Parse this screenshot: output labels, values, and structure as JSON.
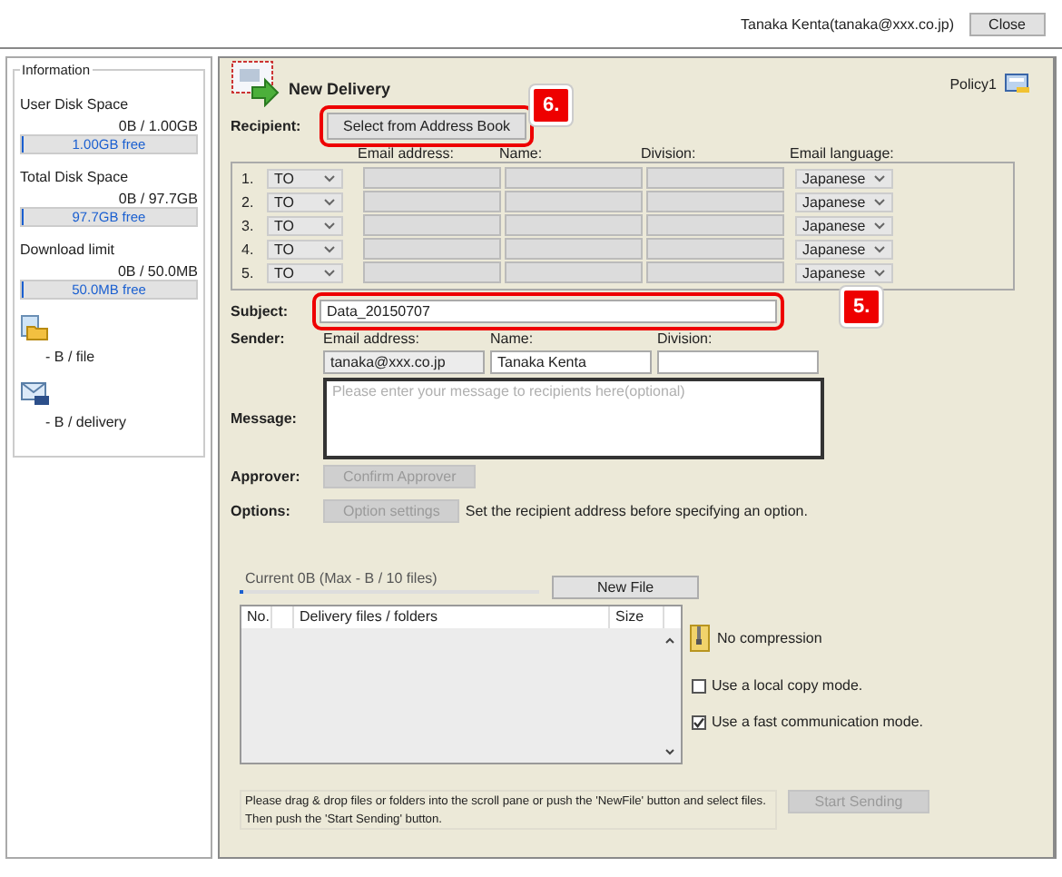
{
  "top_bar": {
    "user": "Tanaka Kenta(tanaka@xxx.co.jp)",
    "close_button": "Close"
  },
  "info_panel": {
    "title": "Information",
    "meters": [
      {
        "label": "User Disk Space",
        "reading": "0B / 1.00GB",
        "bar_text": "1.00GB free",
        "level": 0.01
      },
      {
        "label": "Total Disk Space",
        "reading": "0B / 97.7GB",
        "bar_text": "97.7GB free",
        "level": 0.01
      },
      {
        "label": "Download limit",
        "reading": "0B / 50.0MB",
        "bar_text": "50.0MB free",
        "level": 0.01
      }
    ],
    "limits": [
      {
        "kind": "file",
        "text": "- B / file"
      },
      {
        "kind": "delivery",
        "text": "- B / delivery"
      }
    ]
  },
  "form": {
    "title": "New Delivery",
    "policy": "Policy1",
    "recipient_label": "Recipient:",
    "address_book_button": "Select from Address Book",
    "address_book_annotation": "6.",
    "recipient_columns": [
      "Email address:",
      "Name:",
      "Division:",
      "Email language:"
    ],
    "recipients": [
      {
        "number": "1.",
        "type": "TO",
        "language": "Japanese"
      },
      {
        "number": "2.",
        "type": "TO",
        "language": "Japanese"
      },
      {
        "number": "3.",
        "type": "TO",
        "language": "Japanese"
      },
      {
        "number": "4.",
        "type": "TO",
        "language": "Japanese"
      },
      {
        "number": "5.",
        "type": "TO",
        "language": "Japanese"
      }
    ],
    "subject_label": "Subject:",
    "subject": "Data_20150707",
    "subject_annotation": "5.",
    "sender_label": "Sender:",
    "sender_columns": [
      "Email address:",
      "Name:",
      "Division:"
    ],
    "sender": {
      "email": "tanaka@xxx.co.jp",
      "name": "Tanaka Kenta"
    },
    "message_label": "Message:",
    "message_placeholder": "Please enter your message to recipients here(optional)",
    "approver_label": "Approver:",
    "approver_button": {
      "label": "Confirm Approver",
      "disabled": true
    },
    "options_label": "Options:",
    "options_button": {
      "label": "Option settings",
      "disabled": true
    },
    "options_hint": "Set the recipient address before specifying an option."
  },
  "files": {
    "current": "Current 0B (Max - B / 10 files)",
    "level": 0.01,
    "new_file_button": "New File",
    "columns": [
      "No.",
      "Delivery files / folders",
      "Size"
    ],
    "compression": "No compression",
    "options": [
      {
        "label": "Use a local copy mode.",
        "checked": false
      },
      {
        "label": "Use a fast communication mode.",
        "checked": true
      }
    ],
    "hint": "Please drag & drop files or folders into the scroll pane or push the 'NewFile' button and select files. Then push the 'Start Sending' button.",
    "send_button": {
      "label": "Start Sending",
      "disabled": true
    }
  }
}
